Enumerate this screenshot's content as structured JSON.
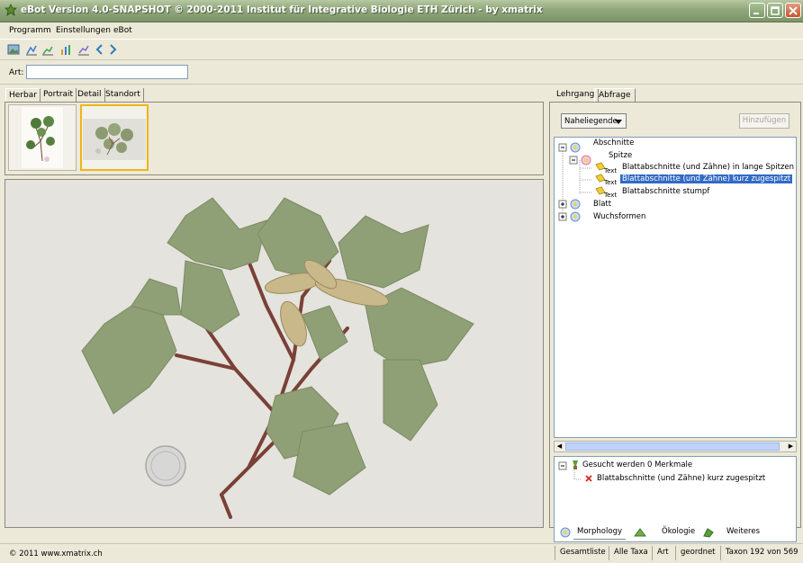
{
  "window": {
    "title": "eBot Version 4.0-SNAPSHOT © 2000-2011 Institut für Integrative Biologie ETH Zürich - by xmatrix"
  },
  "menu": [
    {
      "label": "Programm"
    },
    {
      "label": "Einstellungen"
    },
    {
      "label": "eBot"
    }
  ],
  "toolbar": {
    "icons": [
      "image-icon",
      "chart-icon",
      "chart-icon",
      "chart-icon",
      "chart-icon",
      "prev-icon",
      "next-icon"
    ]
  },
  "search": {
    "label": "Art:",
    "value": ""
  },
  "left_tabs": [
    "Herbar",
    "Portrait",
    "Detail",
    "Standort"
  ],
  "right_tabs": [
    "Lehrgang",
    "Abfrage"
  ],
  "query": {
    "dropdown_value": "Naheliegende",
    "add_button": "Hinzufügen",
    "tree": {
      "abschnitte": "Abschnitte",
      "spitze": "Spitze",
      "text_tag": "Text",
      "item1": "Blattabschnitte (und Zähne) in lange Spitzen ausge",
      "item2": "Blattabschnitte (und Zähne) kurz zugespitzt",
      "item3": "Blattabschnitte stumpf",
      "blatt": "Blatt",
      "wuchsformen": "Wuchsformen"
    },
    "result": {
      "header": "Gesucht werden 0 Merkmale",
      "item": "Blattabschnitte (und Zähne) kurz zugespitzt"
    }
  },
  "bottom_tabs": [
    "Morphology",
    "Ökologie",
    "Weiteres"
  ],
  "status": {
    "copyright": "© 2011 www.xmatrix.ch",
    "gesamtliste": "Gesamtliste",
    "alle_taxa": "Alle Taxa",
    "art": "Art",
    "geordnet": "geordnet",
    "taxon": "Taxon 192 von 569"
  }
}
